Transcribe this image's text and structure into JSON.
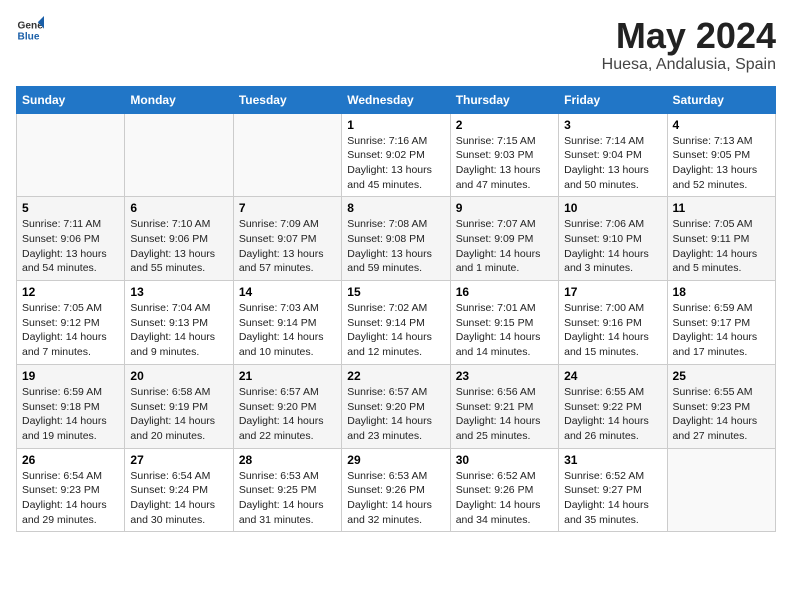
{
  "header": {
    "logo_general": "General",
    "logo_blue": "Blue",
    "title": "May 2024",
    "subtitle": "Huesa, Andalusia, Spain"
  },
  "weekdays": [
    "Sunday",
    "Monday",
    "Tuesday",
    "Wednesday",
    "Thursday",
    "Friday",
    "Saturday"
  ],
  "weeks": [
    [
      {
        "day": "",
        "info": ""
      },
      {
        "day": "",
        "info": ""
      },
      {
        "day": "",
        "info": ""
      },
      {
        "day": "1",
        "info": "Sunrise: 7:16 AM\nSunset: 9:02 PM\nDaylight: 13 hours\nand 45 minutes."
      },
      {
        "day": "2",
        "info": "Sunrise: 7:15 AM\nSunset: 9:03 PM\nDaylight: 13 hours\nand 47 minutes."
      },
      {
        "day": "3",
        "info": "Sunrise: 7:14 AM\nSunset: 9:04 PM\nDaylight: 13 hours\nand 50 minutes."
      },
      {
        "day": "4",
        "info": "Sunrise: 7:13 AM\nSunset: 9:05 PM\nDaylight: 13 hours\nand 52 minutes."
      }
    ],
    [
      {
        "day": "5",
        "info": "Sunrise: 7:11 AM\nSunset: 9:06 PM\nDaylight: 13 hours\nand 54 minutes."
      },
      {
        "day": "6",
        "info": "Sunrise: 7:10 AM\nSunset: 9:06 PM\nDaylight: 13 hours\nand 55 minutes."
      },
      {
        "day": "7",
        "info": "Sunrise: 7:09 AM\nSunset: 9:07 PM\nDaylight: 13 hours\nand 57 minutes."
      },
      {
        "day": "8",
        "info": "Sunrise: 7:08 AM\nSunset: 9:08 PM\nDaylight: 13 hours\nand 59 minutes."
      },
      {
        "day": "9",
        "info": "Sunrise: 7:07 AM\nSunset: 9:09 PM\nDaylight: 14 hours\nand 1 minute."
      },
      {
        "day": "10",
        "info": "Sunrise: 7:06 AM\nSunset: 9:10 PM\nDaylight: 14 hours\nand 3 minutes."
      },
      {
        "day": "11",
        "info": "Sunrise: 7:05 AM\nSunset: 9:11 PM\nDaylight: 14 hours\nand 5 minutes."
      }
    ],
    [
      {
        "day": "12",
        "info": "Sunrise: 7:05 AM\nSunset: 9:12 PM\nDaylight: 14 hours\nand 7 minutes."
      },
      {
        "day": "13",
        "info": "Sunrise: 7:04 AM\nSunset: 9:13 PM\nDaylight: 14 hours\nand 9 minutes."
      },
      {
        "day": "14",
        "info": "Sunrise: 7:03 AM\nSunset: 9:14 PM\nDaylight: 14 hours\nand 10 minutes."
      },
      {
        "day": "15",
        "info": "Sunrise: 7:02 AM\nSunset: 9:14 PM\nDaylight: 14 hours\nand 12 minutes."
      },
      {
        "day": "16",
        "info": "Sunrise: 7:01 AM\nSunset: 9:15 PM\nDaylight: 14 hours\nand 14 minutes."
      },
      {
        "day": "17",
        "info": "Sunrise: 7:00 AM\nSunset: 9:16 PM\nDaylight: 14 hours\nand 15 minutes."
      },
      {
        "day": "18",
        "info": "Sunrise: 6:59 AM\nSunset: 9:17 PM\nDaylight: 14 hours\nand 17 minutes."
      }
    ],
    [
      {
        "day": "19",
        "info": "Sunrise: 6:59 AM\nSunset: 9:18 PM\nDaylight: 14 hours\nand 19 minutes."
      },
      {
        "day": "20",
        "info": "Sunrise: 6:58 AM\nSunset: 9:19 PM\nDaylight: 14 hours\nand 20 minutes."
      },
      {
        "day": "21",
        "info": "Sunrise: 6:57 AM\nSunset: 9:20 PM\nDaylight: 14 hours\nand 22 minutes."
      },
      {
        "day": "22",
        "info": "Sunrise: 6:57 AM\nSunset: 9:20 PM\nDaylight: 14 hours\nand 23 minutes."
      },
      {
        "day": "23",
        "info": "Sunrise: 6:56 AM\nSunset: 9:21 PM\nDaylight: 14 hours\nand 25 minutes."
      },
      {
        "day": "24",
        "info": "Sunrise: 6:55 AM\nSunset: 9:22 PM\nDaylight: 14 hours\nand 26 minutes."
      },
      {
        "day": "25",
        "info": "Sunrise: 6:55 AM\nSunset: 9:23 PM\nDaylight: 14 hours\nand 27 minutes."
      }
    ],
    [
      {
        "day": "26",
        "info": "Sunrise: 6:54 AM\nSunset: 9:23 PM\nDaylight: 14 hours\nand 29 minutes."
      },
      {
        "day": "27",
        "info": "Sunrise: 6:54 AM\nSunset: 9:24 PM\nDaylight: 14 hours\nand 30 minutes."
      },
      {
        "day": "28",
        "info": "Sunrise: 6:53 AM\nSunset: 9:25 PM\nDaylight: 14 hours\nand 31 minutes."
      },
      {
        "day": "29",
        "info": "Sunrise: 6:53 AM\nSunset: 9:26 PM\nDaylight: 14 hours\nand 32 minutes."
      },
      {
        "day": "30",
        "info": "Sunrise: 6:52 AM\nSunset: 9:26 PM\nDaylight: 14 hours\nand 34 minutes."
      },
      {
        "day": "31",
        "info": "Sunrise: 6:52 AM\nSunset: 9:27 PM\nDaylight: 14 hours\nand 35 minutes."
      },
      {
        "day": "",
        "info": ""
      }
    ]
  ]
}
